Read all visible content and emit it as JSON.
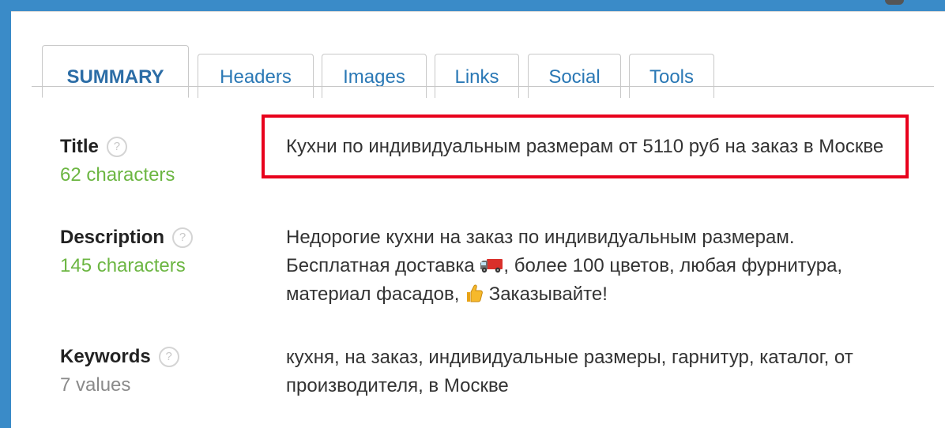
{
  "tabs": [
    {
      "label": "Summary",
      "active": true
    },
    {
      "label": "Headers",
      "active": false
    },
    {
      "label": "Images",
      "active": false
    },
    {
      "label": "Links",
      "active": false
    },
    {
      "label": "Social",
      "active": false
    },
    {
      "label": "Tools",
      "active": false
    }
  ],
  "help_glyph": "?",
  "fields": {
    "title": {
      "label": "Title",
      "count": "62 characters",
      "value": "Кухни по индивидуальным размерам от 5110 руб на заказ в Москве"
    },
    "description": {
      "label": "Description",
      "count": "145 characters",
      "value_part1": "Недорогие кухни на заказ по индивидуальным размерам. Бесплатная доставка ",
      "value_part2": ", более 100 цветов, любая фурнитура, материал фасадов, ",
      "value_part3": " Заказывайте!"
    },
    "keywords": {
      "label": "Keywords",
      "count": "7 values",
      "value": "кухня, на заказ, индивидуальные размеры, гарнитур, каталог, от производителя, в Москве"
    }
  },
  "icons": {
    "truck": "delivery-truck-icon",
    "thumb": "thumbs-up-icon",
    "help": "help-icon"
  },
  "colors": {
    "frame": "#3a8bc8",
    "tab_text": "#2a78b5",
    "count_green": "#6cb642",
    "count_grey": "#8a8a8a",
    "highlight": "#e8001c"
  }
}
